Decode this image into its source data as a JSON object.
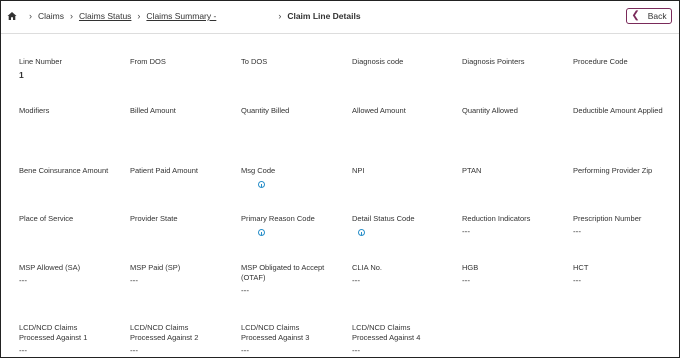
{
  "breadcrumb": {
    "home_icon": "home-icon",
    "items": [
      "Claims",
      "Claims Status",
      "Claims Summary -"
    ],
    "current": "Claim Line Details"
  },
  "back_label": "Back",
  "fields": [
    {
      "label": "Line Number",
      "value": "1"
    },
    {
      "label": "From DOS",
      "value": ""
    },
    {
      "label": "To DOS",
      "value": ""
    },
    {
      "label": "Diagnosis code",
      "value": ""
    },
    {
      "label": "Diagnosis Pointers",
      "value": ""
    },
    {
      "label": "Procedure Code",
      "value": ""
    },
    {
      "label": "Modifiers",
      "value": ""
    },
    {
      "label": "Billed Amount",
      "value": ""
    },
    {
      "label": "Quantity Billed",
      "value": ""
    },
    {
      "label": "Allowed Amount",
      "value": ""
    },
    {
      "label": "Quantity Allowed",
      "value": ""
    },
    {
      "label": "Deductible Amount Applied",
      "value": ""
    },
    {
      "label": "Bene Coinsurance Amount",
      "value": ""
    },
    {
      "label": "Patient Paid Amount",
      "value": ""
    },
    {
      "label": "Msg Code",
      "value": ""
    },
    {
      "label": "NPI",
      "value": ""
    },
    {
      "label": "PTAN",
      "value": ""
    },
    {
      "label": "Performing Provider Zip",
      "value": ""
    },
    {
      "label": "Place of Service",
      "value": ""
    },
    {
      "label": "Provider State",
      "value": ""
    },
    {
      "label": "Primary Reason Code",
      "value": ""
    },
    {
      "label": "Detail Status Code",
      "value": ""
    },
    {
      "label": "Reduction Indicators",
      "value": "---"
    },
    {
      "label": "Prescription Number",
      "value": "---"
    },
    {
      "label": "MSP Allowed (SA)",
      "value": "---"
    },
    {
      "label": "MSP Paid (SP)",
      "value": "---"
    },
    {
      "label": "MSP Obligated to Accept (OTAF)",
      "value": "---"
    },
    {
      "label": "CLIA No.",
      "value": "---"
    },
    {
      "label": "HGB",
      "value": "---"
    },
    {
      "label": "HCT",
      "value": "---"
    },
    {
      "label": "LCD/NCD Claims Processed Against 1",
      "value": "---"
    },
    {
      "label": "LCD/NCD Claims Processed Against 2",
      "value": "---"
    },
    {
      "label": "LCD/NCD Claims Processed Against 3",
      "value": "---"
    },
    {
      "label": "LCD/NCD Claims Processed Against 4",
      "value": "---"
    }
  ],
  "colors": {
    "accent": "#7a2a5a",
    "info": "#2a8fc9"
  }
}
